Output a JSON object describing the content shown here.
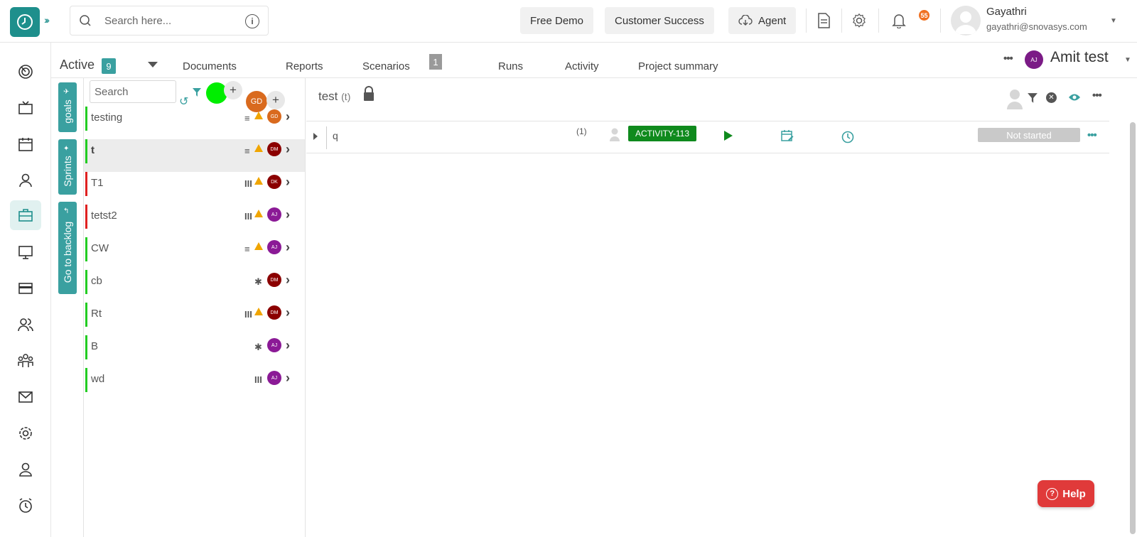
{
  "colors": {
    "accent": "#3aa0a0",
    "brand": "#1e8f8c",
    "activity_tag": "#0f8a1d",
    "help": "#e03a3a",
    "warning": "#f0a500"
  },
  "topbar": {
    "search_placeholder": "Search here...",
    "free_demo": "Free Demo",
    "customer_success": "Customer Success",
    "agent": "Agent",
    "notification_count": "55",
    "user_name": "Gayathri",
    "user_email": "gayathri@snovasys.com"
  },
  "subheader": {
    "active_label": "Active",
    "active_count": "9",
    "tabs": [
      {
        "label": "Documents"
      },
      {
        "label": "Reports"
      },
      {
        "label": "Scenarios"
      },
      {
        "label": "Runs"
      },
      {
        "label": "Activity"
      },
      {
        "label": "Project summary"
      }
    ],
    "scenarios_count": "1",
    "project_avatar": "AJ",
    "project_name": "Amit test"
  },
  "vertical_tabs": {
    "goals": "goals",
    "sprints": "Sprints",
    "backlog": "Go to backlog"
  },
  "list": {
    "search_placeholder": "Search",
    "add_avatar": "GD",
    "items": [
      {
        "name": "testing",
        "bar": "#22cc22",
        "priority": "≡",
        "warn": true,
        "avatar": "GD",
        "avatar_color": "#d96a1e"
      },
      {
        "name": "t",
        "bar": "#22cc22",
        "priority": "≡",
        "warn": true,
        "avatar": "DM",
        "avatar_color": "#8b0000"
      },
      {
        "name": "T1",
        "bar": "#e02020",
        "priority": "III",
        "warn": true,
        "avatar": "DK",
        "avatar_color": "#8b0000"
      },
      {
        "name": "tetst2",
        "bar": "#e02020",
        "priority": "III",
        "warn": true,
        "avatar": "AJ",
        "avatar_color": "#8b1a96"
      },
      {
        "name": "CW",
        "bar": "#22cc22",
        "priority": "≡",
        "warn": true,
        "avatar": "AJ",
        "avatar_color": "#8b1a96"
      },
      {
        "name": "cb",
        "bar": "#22cc22",
        "priority": "✱",
        "warn": false,
        "avatar": "DM",
        "avatar_color": "#8b0000"
      },
      {
        "name": "Rt",
        "bar": "#22cc22",
        "priority": "III",
        "warn": true,
        "avatar": "DM",
        "avatar_color": "#8b0000"
      },
      {
        "name": "B",
        "bar": "#22cc22",
        "priority": "✱",
        "warn": false,
        "avatar": "AJ",
        "avatar_color": "#8b1a96"
      },
      {
        "name": "wd",
        "bar": "#22cc22",
        "priority": "III",
        "warn": false,
        "avatar": "AJ",
        "avatar_color": "#8b1a96"
      }
    ]
  },
  "main": {
    "title": "test",
    "title_sub": "(t)",
    "row": {
      "name": "q",
      "count": "(1)",
      "tag": "ACTIVITY-113",
      "status": "Not started"
    }
  },
  "help": {
    "label": "Help"
  }
}
